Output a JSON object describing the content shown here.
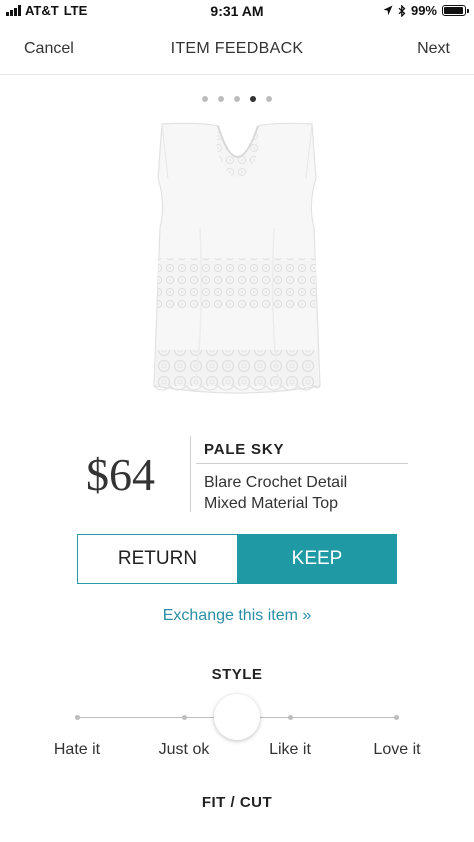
{
  "status_bar": {
    "carrier": "AT&T",
    "network": "LTE",
    "time": "9:31 AM",
    "battery": "99%",
    "battery_level": 0.99,
    "icons": [
      "signal-icon",
      "location-arrow-icon",
      "bluetooth-icon",
      "battery-icon"
    ]
  },
  "nav": {
    "cancel_label": "Cancel",
    "title": "ITEM FEEDBACK",
    "next_label": "Next"
  },
  "pager": {
    "count": 5,
    "active_index": 3
  },
  "product": {
    "price": "$64",
    "brand": "PALE SKY",
    "name_line1": "Blare Crochet Detail",
    "name_line2": "Mixed Material Top"
  },
  "actions": {
    "return_label": "RETURN",
    "keep_label": "KEEP",
    "exchange_label": "Exchange this item »"
  },
  "style_rating": {
    "title": "STYLE",
    "options": [
      "Hate it",
      "Just ok",
      "Like it",
      "Love it"
    ],
    "selected_position": 0.5
  },
  "fit_section": {
    "title": "FIT / CUT"
  },
  "colors": {
    "accent": "#1f9aa5",
    "link": "#2a8fa5",
    "track": "#bdbdbd"
  }
}
